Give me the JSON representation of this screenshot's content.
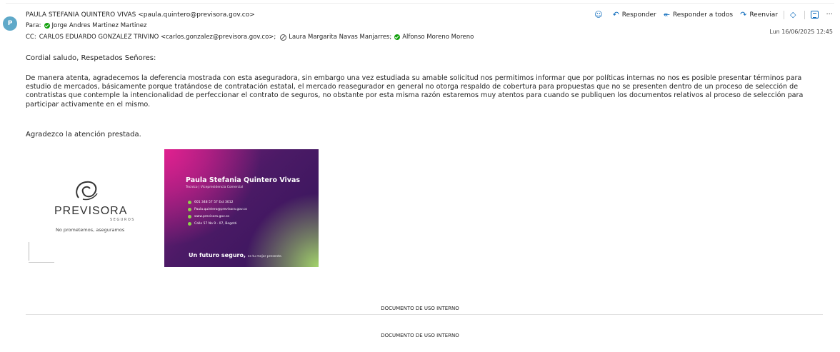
{
  "header": {
    "avatar_initial": "P",
    "from": "PAULA STEFANIA QUINTERO VIVAS <paula.quintero@previsora.gov.co>",
    "to_label": "Para:",
    "to": "Jorge Andres Martinez Martinez",
    "cc_label": "CC:",
    "cc_1": "CARLOS EDUARDO GONZALEZ TRIVINO <carlos.gonzalez@previsora.gov.co>;",
    "cc_2": "Laura Margarita Navas Manjarres;",
    "cc_3": "Alfonso Moreno Moreno",
    "date": "Lun 16/06/2025 12:45"
  },
  "actions": {
    "reply": "Responder",
    "reply_all": "Responder a todos",
    "forward": "Reenviar",
    "more": "···"
  },
  "body": {
    "greeting": "Cordial saludo, Respetados Señores:",
    "paragraph": "De manera atenta, agradecemos la deferencia mostrada con esta aseguradora, sin embargo una vez estudiada su amable solicitud nos permitimos informar que por políticas internas no nos es posible presentar términos para estudio de mercados, básicamente porque tratándose de contratación estatal, el mercado reasegurador en general no otorga respaldo de cobertura para propuestas que no se presenten dentro de un proceso de selección de contratistas que contemple la intencionalidad de perfeccionar el contrato de seguros, no obstante por esta misma razón estaremos muy atentos para cuando se publiquen los documentos relativos al proceso de selección para participar activamente en el mismo.",
    "thanks": "Agradezco la atención prestada."
  },
  "signature": {
    "logo_text": "PREVISORA",
    "logo_sub": "SEGUROS",
    "slogan": "No prometemos, aseguramos",
    "card_name": "Paula Stefania Quintero Vivas",
    "card_role": "Tecnico | Vicepresidencia Comercial",
    "card_phone": "601 348 57 57 Ext 3012",
    "card_email": "Paula.quintero@previsora.gov.co",
    "card_web": "www.previsora.gov.co",
    "card_address": "Calle 57 No 9 - 07, Bogotá",
    "card_tagline": "Un futuro seguro,",
    "card_tagline_small": "es tu mejor presente."
  },
  "footer": {
    "notice_1": "DOCUMENTO DE USO INTERNO",
    "notice_2": "DOCUMENTO DE USO INTERNO"
  },
  "colors": {
    "accent": "#0f6cbd",
    "presence_green": "#13a10e",
    "avatar": "#5fa9c9",
    "card_pink": "#e0208f",
    "card_purple": "#4b1a66",
    "card_green": "#a3d46a"
  }
}
